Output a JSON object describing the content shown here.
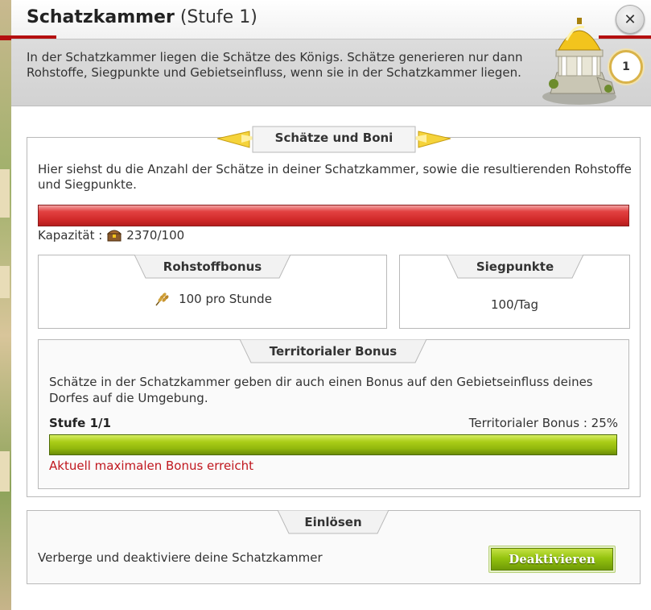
{
  "dialog": {
    "title": "Schatzkammer",
    "level_label": "(Stufe 1)",
    "close_label": "✕",
    "description": "In der Schatzkammer liegen die Schätze des Königs. Schätze generieren nur dann Rohstoffe, Siegpunkte und Gebietseinfluss, wenn sie in der Schatzkammer liegen.",
    "level_badge": "1"
  },
  "treasures": {
    "heading": "Schätze und Boni",
    "intro": "Hier siehst du die Anzahl der Schätze in deiner Schatzkammer, sowie die resultierenden Rohstoffe und Siegpunkte.",
    "capacity_label": "Kapazität :",
    "capacity_value": "2370/100",
    "capacity_fill": 1.0,
    "chest_icon": "treasure-chest-icon"
  },
  "resource_bonus": {
    "heading": "Rohstoffbonus",
    "value": "100 pro Stunde",
    "icon": "wheat-icon"
  },
  "victory_points": {
    "heading": "Siegpunkte",
    "value": "100/Tag"
  },
  "territorial": {
    "heading": "Territorialer Bonus",
    "text": "Schätze in der Schatzkammer geben dir auch einen Bonus auf den Gebietseinfluss deines Dorfes auf die Umgebung.",
    "level_label": "Stufe 1/1",
    "bonus_label": "Territorialer Bonus : 25%",
    "progress": 1.0,
    "max_message": "Aktuell maximalen Bonus erreicht"
  },
  "redeem": {
    "heading": "Einlösen",
    "text": "Verberge und deaktiviere deine Schatzkammer",
    "button_label": "Deaktivieren"
  },
  "colors": {
    "capacity_bar": "#d12a2a",
    "progress_bar": "#9ac313",
    "warning_text": "#c0171e",
    "title_stripe": "#b40f0f",
    "button": "#94c30f"
  }
}
